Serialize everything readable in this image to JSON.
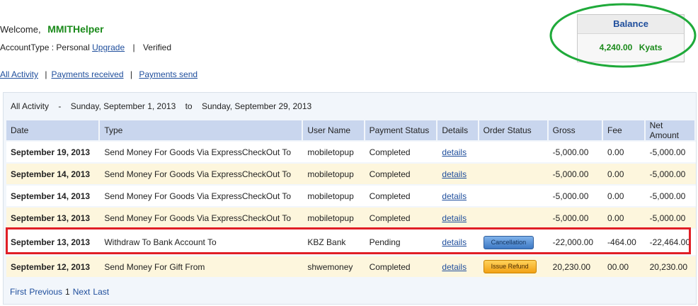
{
  "welcome": {
    "label": "Welcome,",
    "username": "MMITHelper"
  },
  "account": {
    "label": "AccountType",
    "colon": ":",
    "type": "Personal",
    "upgrade": "Upgrade",
    "separator": "|",
    "status": "Verified"
  },
  "nav": {
    "all_activity": "All Activity",
    "separator": "|",
    "payments_received": "Payments received",
    "payments_send": "Payments send"
  },
  "balance": {
    "title": "Balance",
    "amount": "4,240.00",
    "currency": "Kyats"
  },
  "range": {
    "label": "All Activity",
    "dash": "-",
    "from": "Sunday, September 1, 2013",
    "to_word": "to",
    "to": "Sunday, September 29, 2013"
  },
  "table": {
    "headers": [
      "Date",
      "Type",
      "User Name",
      "Payment Status",
      "Details",
      "Order Status",
      "Gross",
      "Fee",
      "Net Amount"
    ],
    "rows": [
      {
        "date": "September 19, 2013",
        "type": "Send Money For Goods Via ExpressCheckOut To",
        "user": "mobiletopup",
        "status": "Completed",
        "details": "details",
        "order": "",
        "gross": "-5,000.00",
        "fee": "0.00",
        "net": "-5,000.00"
      },
      {
        "date": "September 14, 2013",
        "type": "Send Money For Goods Via ExpressCheckOut To",
        "user": "mobiletopup",
        "status": "Completed",
        "details": "details",
        "order": "",
        "gross": "-5,000.00",
        "fee": "0.00",
        "net": "-5,000.00"
      },
      {
        "date": "September 14, 2013",
        "type": "Send Money For Goods Via ExpressCheckOut To",
        "user": "mobiletopup",
        "status": "Completed",
        "details": "details",
        "order": "",
        "gross": "-5,000.00",
        "fee": "0.00",
        "net": "-5,000.00"
      },
      {
        "date": "September 13, 2013",
        "type": "Send Money For Goods Via ExpressCheckOut To",
        "user": "mobiletopup",
        "status": "Completed",
        "details": "details",
        "order": "",
        "gross": "-5,000.00",
        "fee": "0.00",
        "net": "-5,000.00"
      },
      {
        "date": "September 13, 2013",
        "type": "Withdraw To Bank Account To",
        "user": "KBZ Bank",
        "status": "Pending",
        "details": "details",
        "order": "Cancellation",
        "gross": "-22,000.00",
        "fee": "-464.00",
        "net": "-22,464.00"
      },
      {
        "date": "September 12, 2013",
        "type": "Send Money For Gift From",
        "user": "shwemoney",
        "status": "Completed",
        "details": "details",
        "order": "Issue Refund",
        "gross": "20,230.00",
        "fee": "00.00",
        "net": "20,230.00"
      }
    ]
  },
  "pager": {
    "first": "First",
    "previous": "Previous",
    "current": "1",
    "next": "Next",
    "last": "Last"
  },
  "colors": {
    "accent_green": "#1a8a1a",
    "link_blue": "#1f4e9c",
    "header_bg": "#c9d6ee",
    "highlight_red": "#e01f26",
    "oval_green": "#1faa3a"
  }
}
